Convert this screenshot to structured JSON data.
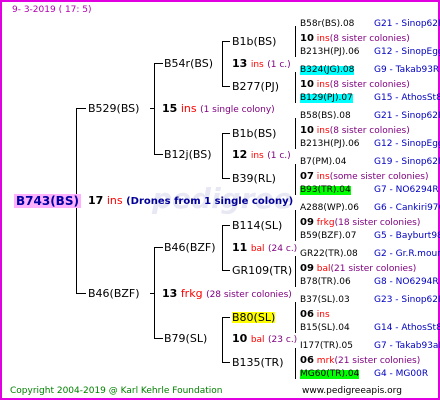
{
  "header": {
    "date": "9-  3-2019 ( 17:  5)"
  },
  "root": {
    "name": "B743(BS)",
    "count": "17",
    "unit": "ins",
    "note": "(Drones from 1 single colony)"
  },
  "g1": [
    {
      "name": "B529(BS)",
      "count": "15",
      "unit": "ins",
      "note": "(1 single colony)"
    },
    {
      "name": "B46(BZF)",
      "count": "13",
      "unit": "frkg",
      "note": "(28 sister colonies)"
    }
  ],
  "g2": [
    {
      "name": "B54r(BS)",
      "count": "13",
      "unit": "ins",
      "note": "(1 c.)"
    },
    {
      "name": "B12j(BS)",
      "count": "12",
      "unit": "ins",
      "note": "(1 c.)"
    },
    {
      "name": "B46(BZF)",
      "count": "11",
      "unit": "bal",
      "note": "(24 c.)"
    },
    {
      "name": "B79(SL)",
      "count": "10",
      "unit": "bal",
      "note": "(23 c.)"
    }
  ],
  "g3": [
    {
      "name": "B1b(BS)"
    },
    {
      "name": "B277(PJ)"
    },
    {
      "name": "B1b(BS)"
    },
    {
      "name": "B39(RL)"
    },
    {
      "name": "B114(SL)"
    },
    {
      "name": "GR109(TR)"
    },
    {
      "name": "B80(SL)"
    },
    {
      "name": "B135(TR)"
    }
  ],
  "g4": [
    {
      "top": "B58r(BS).08",
      "top_id": "G21 - Sinop62R",
      "mid_count": "10",
      "mid_unit": "ins",
      "mid_note": "(8 sister colonies)",
      "bot": "B213H(PJ).06",
      "bot_id": "G12 - SinopEgg86R"
    },
    {
      "top": "B324(JG).08",
      "top_id": "G9 - Takab93R",
      "mid_count": "10",
      "mid_unit": "ins",
      "mid_note": "(8 sister colonies)",
      "bot": "B129(PJ).07",
      "bot_id": "G15 - AthosSt80R"
    },
    {
      "top": "B58(BS).08",
      "top_id": "G21 - Sinop62R",
      "mid_count": "10",
      "mid_unit": "ins",
      "mid_note": "(8 sister colonies)",
      "bot": "B213H(PJ).06",
      "bot_id": "G12 - SinopEgg86R"
    },
    {
      "top": "B7(PM).04",
      "top_id": "G19 - Sinop62R",
      "mid_count": "07",
      "mid_unit": "ins",
      "mid_note": "(some sister colonies)",
      "bot": "B93(TR).04",
      "bot_id": "G7 - NO6294R"
    },
    {
      "top": "A288(WP).06",
      "top_id": "G6 - Cankiri97Q",
      "mid_count": "09",
      "mid_unit": "frkg",
      "mid_note": "(18 sister colonies)",
      "bot": "B59(BZF).07",
      "bot_id": "G5 - Bayburt98-3"
    },
    {
      "top": "GR22(TR).08",
      "top_id": "G2 - Gr.R.mounta",
      "mid_count": "09",
      "mid_unit": "bal",
      "mid_note": "(21 sister colonies)",
      "bot": "B78(TR).06",
      "bot_id": "G8 - NO6294R"
    },
    {
      "top": "B37(SL).03",
      "top_id": "G23 - Sinop62R",
      "mid_count": "06",
      "mid_unit": "ins",
      "mid_note": "",
      "bot": "B15(SL).04",
      "bot_id": "G14 - AthosSt80R"
    },
    {
      "top": "I177(TR).05",
      "top_id": "G7 - Takab93aR",
      "mid_count": "06",
      "mid_unit": "mrk",
      "mid_note": "(21 sister colonies)",
      "bot": "MG60(TR).04",
      "bot_id": "G4 - MG00R"
    }
  ],
  "footer": {
    "copyright": "Copyright 2004-2019 @ Karl Kehrle Foundation",
    "url": "www.pedigreeapis.org"
  },
  "colors": {
    "frame": "#e000e0",
    "root_bg": "#ffb0ff",
    "cyan": "#00ffff",
    "yellow": "#ffff00",
    "green": "#00ff00"
  }
}
